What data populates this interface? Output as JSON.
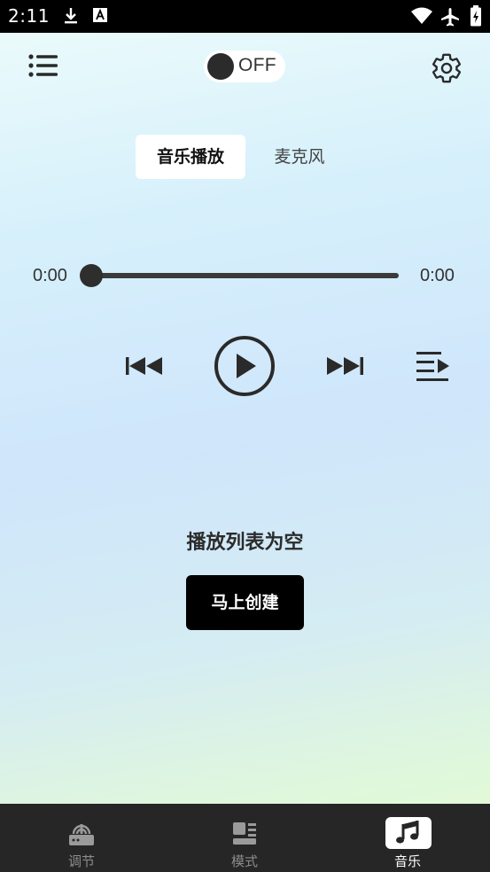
{
  "status_bar": {
    "time": "2:11",
    "icons": [
      "download-icon",
      "a-notification-icon",
      "wifi-icon",
      "airplane-icon",
      "battery-charging-icon"
    ]
  },
  "top_bar": {
    "menu_icon": "list-menu-icon",
    "power_toggle": {
      "label": "OFF",
      "state": "off"
    },
    "settings_icon": "gear-icon"
  },
  "tabs": [
    {
      "label": "音乐播放",
      "active": true
    },
    {
      "label": "麦克风",
      "active": false
    }
  ],
  "player": {
    "elapsed": "0:00",
    "duration": "0:00",
    "progress": 0,
    "controls": [
      "skip-previous-icon",
      "play-icon",
      "skip-next-icon",
      "playlist-icon"
    ]
  },
  "empty_state": {
    "message": "播放列表为空",
    "action_label": "马上创建"
  },
  "bottom_nav": [
    {
      "label": "调节",
      "icon": "equalizer-device-icon",
      "active": false
    },
    {
      "label": "模式",
      "icon": "modes-icon",
      "active": false
    },
    {
      "label": "音乐",
      "icon": "music-note-icon",
      "active": true
    }
  ],
  "colors": {
    "status_bar_bg": "#000000",
    "bottom_nav_bg": "#262626",
    "primary_button_bg": "#000000",
    "active_tab_bg": "#ffffff"
  }
}
